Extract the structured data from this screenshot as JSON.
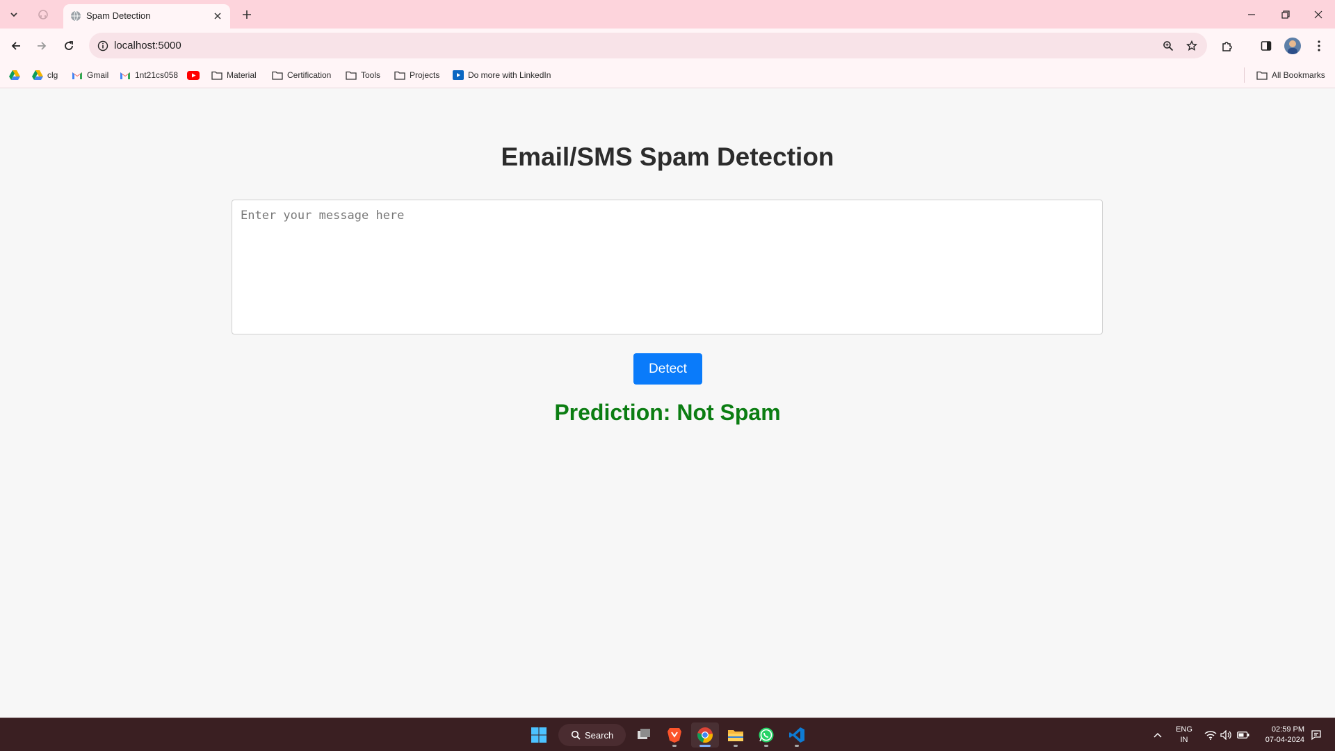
{
  "browser": {
    "tab_title": "Spam Detection",
    "url": "localhost:5000",
    "bookmarks": [
      {
        "label": "",
        "icon": "google-drive-icon"
      },
      {
        "label": "clg",
        "icon": "google-drive-icon"
      },
      {
        "label": "Gmail",
        "icon": "gmail-icon"
      },
      {
        "label": "1nt21cs058",
        "icon": "gmail-icon"
      },
      {
        "label": "",
        "icon": "youtube-icon"
      },
      {
        "label": "Material",
        "icon": "folder-icon"
      },
      {
        "label": "Certification",
        "icon": "folder-icon"
      },
      {
        "label": "Tools",
        "icon": "folder-icon"
      },
      {
        "label": "Projects",
        "icon": "folder-icon"
      },
      {
        "label": "Do more with LinkedIn",
        "icon": "linkedin-learning-icon"
      }
    ],
    "all_bookmarks_label": "All Bookmarks"
  },
  "page": {
    "title": "Email/SMS Spam Detection",
    "input_placeholder": "Enter your message here",
    "input_value": "",
    "detect_label": "Detect",
    "prediction_text": "Prediction: Not Spam",
    "prediction_color": "#0b7d12"
  },
  "taskbar": {
    "search_label": "Search",
    "language": "ENG",
    "region": "IN",
    "time": "02:59 PM",
    "date": "07-04-2024"
  },
  "colors": {
    "tabstrip": "#fdd4dc",
    "detect_button": "#0a7bfa",
    "taskbar": "#3a1f22"
  }
}
